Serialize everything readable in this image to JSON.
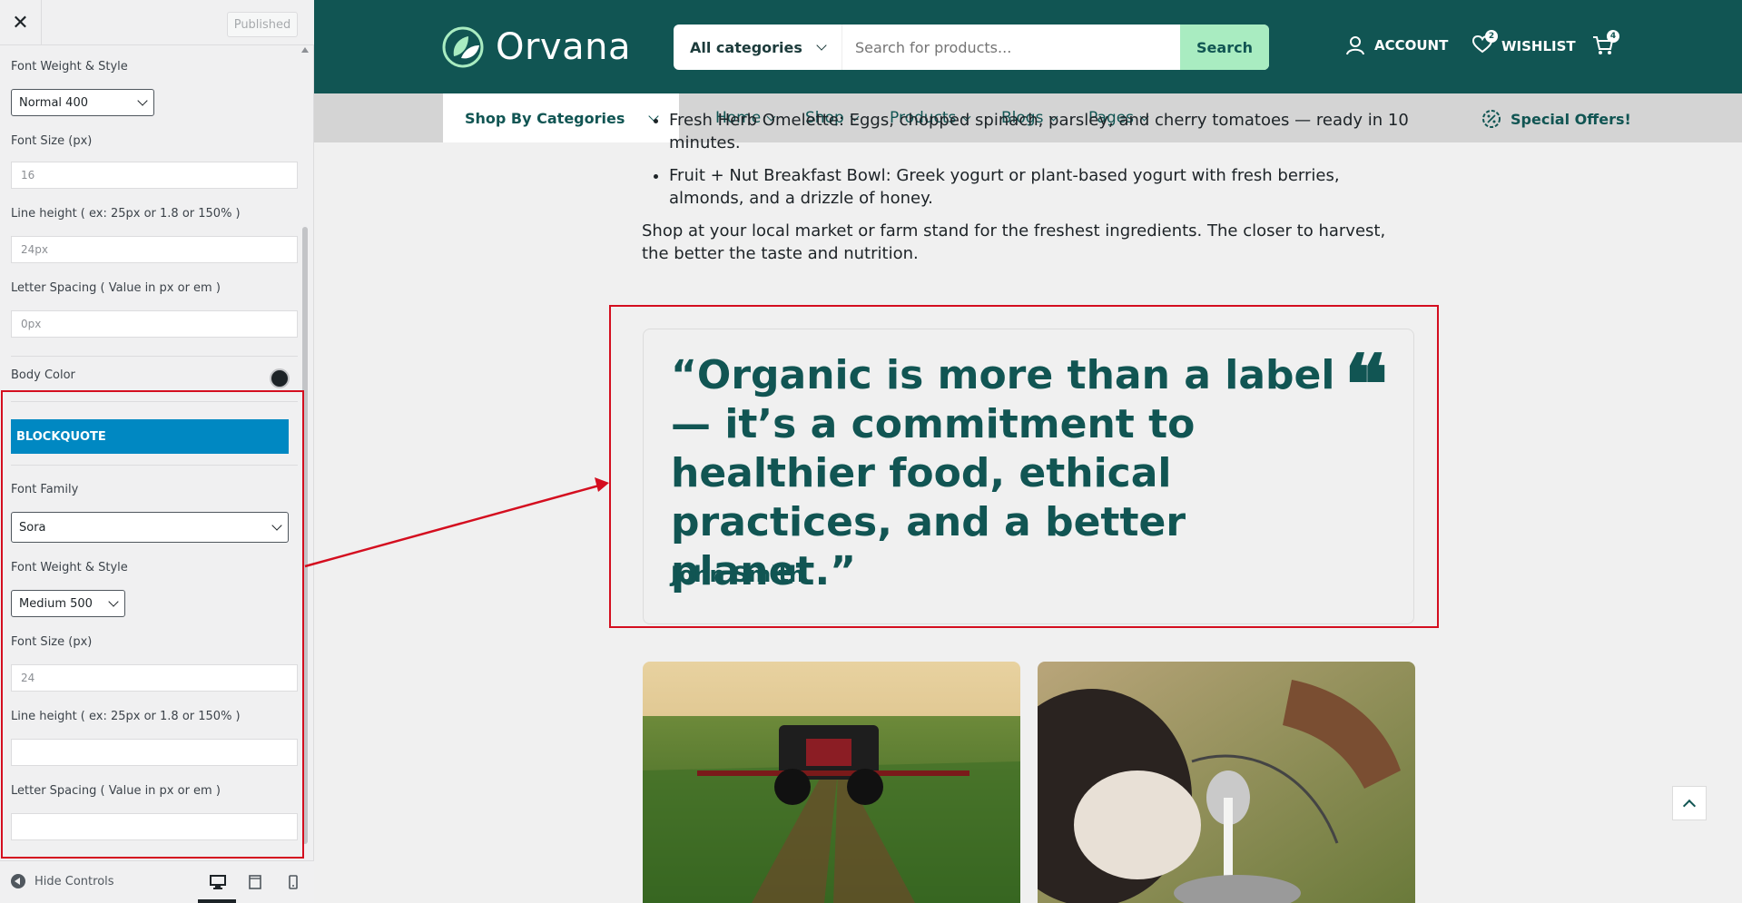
{
  "sidebar": {
    "close_label": "✕",
    "published_label": "Published",
    "fields": {
      "font_weight_label": "Font Weight & Style",
      "font_weight_value": "Normal 400",
      "font_size_label": "Font Size (px)",
      "font_size_value": "16",
      "line_height_label": "Line height ( ex: 25px or 1.8 or 150% )",
      "line_height_value": "24px",
      "letter_spacing_label": "Letter Spacing ( Value in px or em )",
      "letter_spacing_value": "0px",
      "body_color_label": "Body Color",
      "body_color_value": "#1d2327"
    },
    "blockquote": {
      "header": "BLOCKQUOTE",
      "font_family_label": "Font Family",
      "font_family_value": "Sora",
      "font_weight_label": "Font Weight & Style",
      "font_weight_value": "Medium 500",
      "font_size_label": "Font Size (px)",
      "font_size_value": "24",
      "line_height_label": "Line height ( ex: 25px or 1.8 or 150% )",
      "line_height_value": "",
      "letter_spacing_label": "Letter Spacing ( Value in px or em )",
      "letter_spacing_value": ""
    },
    "footer": {
      "hide_controls": "Hide Controls"
    }
  },
  "site": {
    "logo": "Orvana",
    "search": {
      "category": "All categories",
      "placeholder": "Search for products...",
      "button": "Search"
    },
    "header_links": {
      "account": "ACCOUNT",
      "wishlist": "WISHLIST",
      "wishlist_count": "2",
      "cart_count": "4"
    },
    "nav": {
      "shop_by_categories": "Shop By Categories",
      "items": [
        "Home",
        "Shop",
        "Products",
        "Blogs",
        "Pages"
      ],
      "special_offers": "Special Offers!"
    },
    "article": {
      "list": [
        "Fresh Herb Omelette: Eggs, chopped spinach, parsley, and cherry tomatoes — ready in 10 minutes.",
        "Fruit + Nut Breakfast Bowl: Greek yogurt or plant-based yogurt with fresh berries, almonds, and a drizzle of honey."
      ],
      "paragraph": "Shop at your local market or farm stand for the freshest ingredients. The closer to harvest, the better the taste and nutrition."
    },
    "quote": {
      "text": "“Organic is more than a label — it’s a commitment to healthier food, ethical practices, and a better planet.”",
      "author": "John Smith"
    }
  },
  "colors": {
    "brand_green": "#115553",
    "search_button": "#a9ecc1",
    "blockquote_header": "#0088c2",
    "highlight_red": "#d40e1f"
  }
}
